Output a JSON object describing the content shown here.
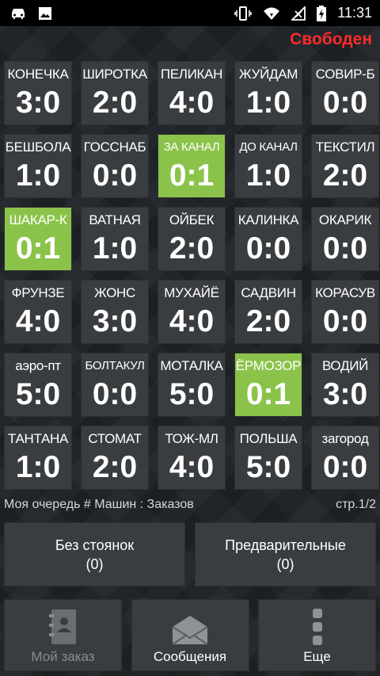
{
  "status_bar": {
    "time": "11:31",
    "left_icons": [
      "car-icon",
      "image-icon"
    ],
    "right_icons": [
      "vibrate-icon",
      "wifi-icon",
      "no-signal-icon",
      "battery-charging-icon"
    ]
  },
  "app_status": {
    "label": "Свободен",
    "color": "#ff2a2a"
  },
  "tiles": [
    {
      "name": "КОНЕЧКА",
      "score": "3:0",
      "active": false
    },
    {
      "name": "ШИРОТКА",
      "score": "2:0",
      "active": false
    },
    {
      "name": "ПЕЛИКАН",
      "score": "4:0",
      "active": false
    },
    {
      "name": "ЖУЙДАМ",
      "score": "1:0",
      "active": false
    },
    {
      "name": "СОВИР-Б",
      "score": "0:0",
      "active": false
    },
    {
      "name": "БЕШБОЛА",
      "score": "1:0",
      "active": false
    },
    {
      "name": "ГОССНАБ",
      "score": "0:0",
      "active": false
    },
    {
      "name": "ЗА КАНАЛ",
      "score": "0:1",
      "active": true
    },
    {
      "name": "ДО КАНАЛ",
      "score": "1:0",
      "active": false
    },
    {
      "name": "ТЕКСТИЛ",
      "score": "2:0",
      "active": false
    },
    {
      "name": "ШАКАР-К",
      "score": "0:1",
      "active": true
    },
    {
      "name": "ВАТНАЯ",
      "score": "1:0",
      "active": false
    },
    {
      "name": "ОЙБЕК",
      "score": "2:0",
      "active": false
    },
    {
      "name": "КАЛИНКА",
      "score": "0:0",
      "active": false
    },
    {
      "name": "ОКАРИК",
      "score": "0:0",
      "active": false
    },
    {
      "name": "ФРУНЗЕ",
      "score": "4:0",
      "active": false
    },
    {
      "name": "ЖОНС",
      "score": "3:0",
      "active": false
    },
    {
      "name": "МУХАЙЁ",
      "score": "4:0",
      "active": false
    },
    {
      "name": "САДВИН",
      "score": "2:0",
      "active": false
    },
    {
      "name": "КОРАСУВ",
      "score": "0:0",
      "active": false
    },
    {
      "name": "аэро-пт",
      "score": "5:0",
      "active": false
    },
    {
      "name": "БОЛТАКУЛ",
      "score": "0:0",
      "active": false
    },
    {
      "name": "МОТАЛКА",
      "score": "5:0",
      "active": false
    },
    {
      "name": "ЁРМОЗОР",
      "score": "0:1",
      "active": true
    },
    {
      "name": "ВОДИЙ",
      "score": "3:0",
      "active": false
    },
    {
      "name": "ТАНТАНА",
      "score": "1:0",
      "active": false
    },
    {
      "name": "СТОМАТ",
      "score": "2:0",
      "active": false
    },
    {
      "name": "ТОЖ-МЛ",
      "score": "4:0",
      "active": false
    },
    {
      "name": "ПОЛЬША",
      "score": "5:0",
      "active": false
    },
    {
      "name": "загород",
      "score": "0:0",
      "active": false
    }
  ],
  "queue": {
    "label": "Моя очередь # Машин : Заказов",
    "page": "стр.1/2"
  },
  "buttons": {
    "no_stands": {
      "label": "Без стоянок",
      "count": "(0)"
    },
    "preliminary": {
      "label": "Предварительные",
      "count": "(0)"
    }
  },
  "nav": {
    "my_order": {
      "label": "Мой заказ",
      "icon": "address-book-icon"
    },
    "messages": {
      "label": "Сообщения",
      "icon": "envelope-icon"
    },
    "more": {
      "label": "Еще",
      "icon": "more-icon"
    }
  },
  "colors": {
    "tile_bg": "#3a3d40",
    "tile_active": "#8bc34a",
    "status_red": "#ff2a2a"
  }
}
